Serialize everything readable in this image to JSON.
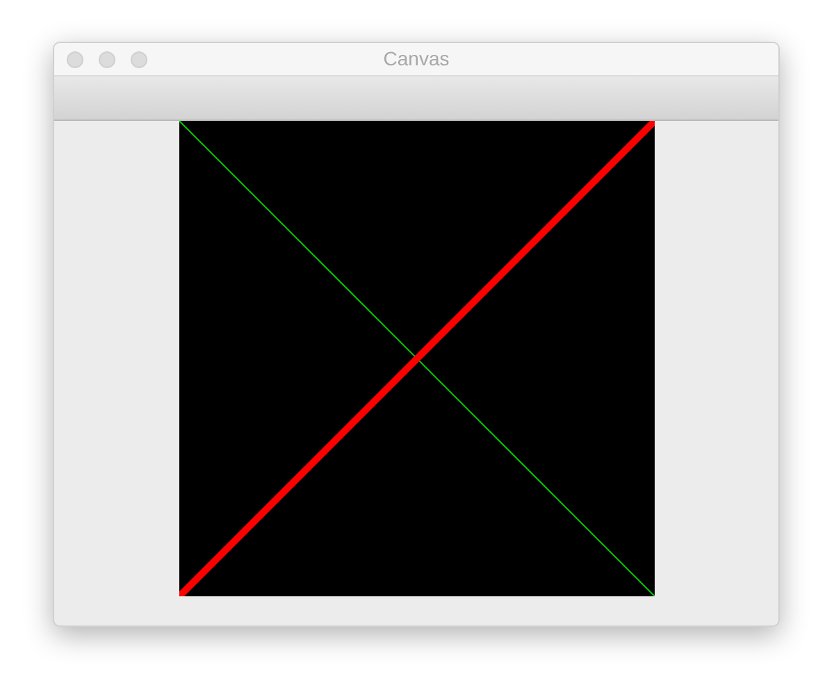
{
  "window": {
    "title": "Canvas"
  }
}
